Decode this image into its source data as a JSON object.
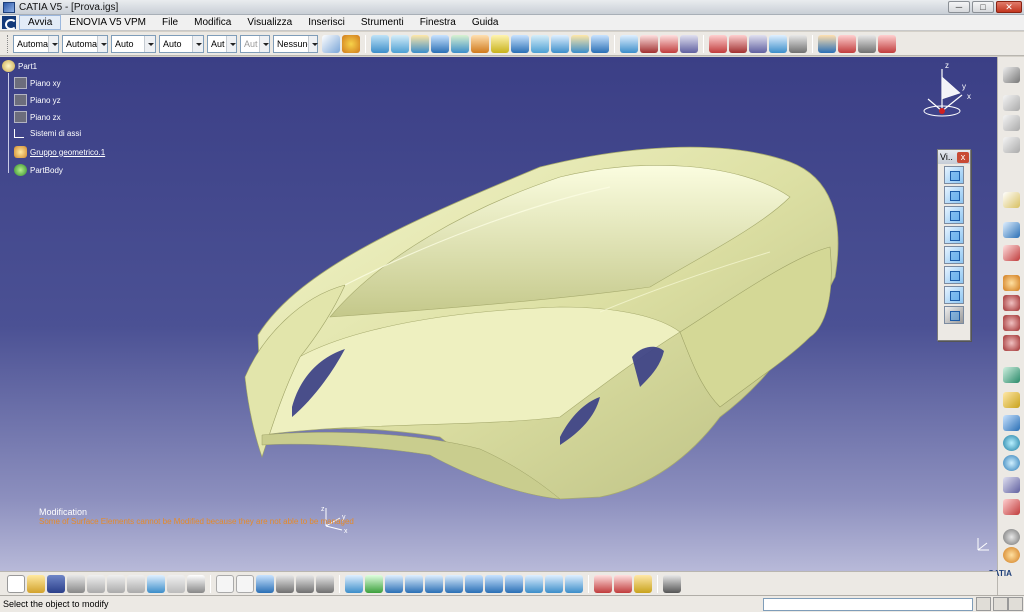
{
  "window": {
    "title": "CATIA V5 - [Prova.igs]",
    "minimize": "─",
    "maximize": "□",
    "close": "✕"
  },
  "menu": {
    "items": [
      "Avvia",
      "ENOVIA V5 VPM",
      "File",
      "Modifica",
      "Visualizza",
      "Inserisci",
      "Strumenti",
      "Finestra",
      "Guida"
    ]
  },
  "toolbar": {
    "combos": [
      {
        "value": "Automa",
        "disabled": false
      },
      {
        "value": "Automa",
        "disabled": false
      },
      {
        "value": "Auto",
        "disabled": false
      },
      {
        "value": "Auto",
        "disabled": false
      },
      {
        "value": "Aut",
        "disabled": false
      },
      {
        "value": "Aut",
        "disabled": true
      },
      {
        "value": "Nessuno",
        "disabled": false
      }
    ]
  },
  "tree": {
    "root": "Part1",
    "items": [
      "Piano xy",
      "Piano yz",
      "Piano zx",
      "Sistemi di assi",
      "Gruppo geometrico.1",
      "PartBody"
    ]
  },
  "views_panel": {
    "title": "Vi..",
    "close": "x"
  },
  "compass": {
    "x": "x",
    "y": "y",
    "z": "z"
  },
  "message": {
    "title": "Modification",
    "text": "Some of Surface Elements cannot be Modified because they are not able to be managed"
  },
  "status": {
    "text": "Select the object to modify"
  },
  "brand": "CATIA",
  "colors": {
    "viewport_top": "#3b3f86",
    "viewport_bottom": "#c6c7e1",
    "car_body": "#e6e9b4",
    "message_text": "#e58a2a"
  }
}
